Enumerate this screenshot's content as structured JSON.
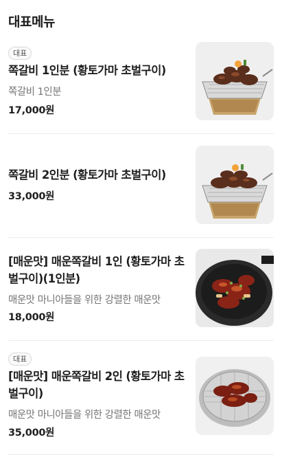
{
  "section": {
    "title": "대표메뉴"
  },
  "menu": {
    "items": [
      {
        "badge": "대표",
        "name": "쪽갈비 1인분 (황토가마 초벌구이)",
        "description": "쪽갈비 1인분",
        "price": "17,000원",
        "image_icon": "grilled-ribs-grill-photo"
      },
      {
        "badge": "",
        "name": "쪽갈비 2인분 (황토가마 초벌구이)",
        "description": "",
        "price": "33,000원",
        "image_icon": "grilled-ribs-grill-photo"
      },
      {
        "badge": "",
        "name": "[매운맛] 매운쪽갈비 1인 (황토가마 초벌구이)(1인분)",
        "description": "매운맛 마니아들을 위한 강렬한 매운맛",
        "price": "18,000원",
        "image_icon": "spicy-ribs-pan-photo"
      },
      {
        "badge": "대표",
        "name": "[매운맛] 매운쪽갈비 2인 (황토가마 초벌구이)",
        "description": "매운맛 마니아들을 위한 강렬한 매운맛",
        "price": "35,000원",
        "image_icon": "spicy-ribs-round-grill-photo"
      }
    ]
  },
  "colors": {
    "text": "#1f1f1f",
    "muted": "#757575",
    "divider": "#ececec"
  }
}
